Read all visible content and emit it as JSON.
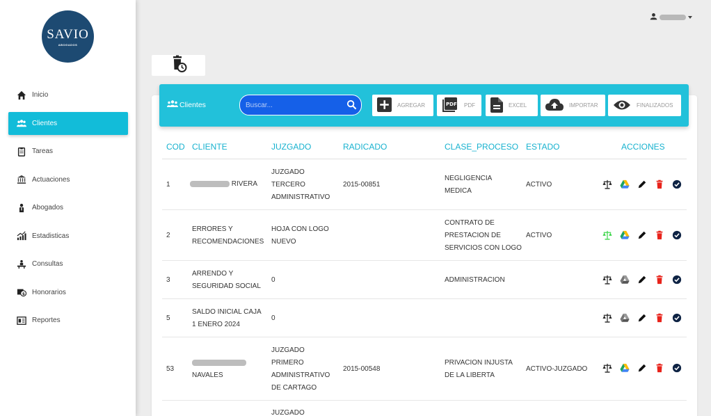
{
  "logo": {
    "main": "SAVIO",
    "sub": "ABOGADOS"
  },
  "nav": [
    {
      "label": "Inicio",
      "icon": "home-icon",
      "active": false
    },
    {
      "label": "Clientes",
      "icon": "users-icon",
      "active": true
    },
    {
      "label": "Tareas",
      "icon": "clipboard-icon",
      "active": false
    },
    {
      "label": "Actuaciones",
      "icon": "courthouse-icon",
      "active": false
    },
    {
      "label": "Abogados",
      "icon": "lawyer-icon",
      "active": false
    },
    {
      "label": "Estadisticas",
      "icon": "chart-icon",
      "active": false
    },
    {
      "label": "Consultas",
      "icon": "consult-icon",
      "active": false
    },
    {
      "label": "Honorarios",
      "icon": "money-icon",
      "active": false
    },
    {
      "label": "Reportes",
      "icon": "report-icon",
      "active": false
    }
  ],
  "banner": {
    "title": "Clientes",
    "search_placeholder": "Buscar...",
    "buttons": {
      "add": "AGREGAR",
      "pdf": "PDF",
      "excel": "EXCEL",
      "import": "IMPORTAR",
      "finished": "FINALIZADOS"
    },
    "pdf_icon_text": "PDF"
  },
  "table": {
    "headers": {
      "cod": "COD",
      "cliente": "CLIENTE",
      "juzgado": "JUZGADO",
      "radicado": "RADICADO",
      "clase": "CLASE_PROCESO",
      "estado": "ESTADO",
      "acciones": "ACCIONES"
    },
    "rows": [
      {
        "cod": "1",
        "cliente": "RIVERA",
        "juzgado": "JUZGADO TERCERO ADMINISTRATIVO",
        "radicado": "2015-00851",
        "clase": "NEGLIGENCIA MEDICA",
        "estado": "ACTIVO"
      },
      {
        "cod": "2",
        "cliente": "ERRORES Y RECOMENDACIONES",
        "juzgado": "HOJA CON LOGO NUEVO",
        "radicado": "",
        "clase": "CONTRATO DE PRESTACION DE SERVICIOS CON LOGO",
        "estado": "ACTIVO"
      },
      {
        "cod": "3",
        "cliente": "ARRENDO Y SEGURIDAD SOCIAL",
        "juzgado": "0",
        "radicado": "",
        "clase": "ADMINISTRACION",
        "estado": ""
      },
      {
        "cod": "5",
        "cliente": "SALDO INICIAL CAJA 1 ENERO 2024",
        "juzgado": "0",
        "radicado": "",
        "clase": "",
        "estado": ""
      },
      {
        "cod": "53",
        "cliente": "NAVALES",
        "juzgado": "JUZGADO PRIMERO ADMINISTRATIVO DE CARTAGO",
        "radicado": "2015-00548",
        "clase": "PRIVACION INJUSTA DE LA LIBERTA",
        "estado": "ACTIVO-JUZGADO"
      },
      {
        "cod": "",
        "cliente": "",
        "juzgado": "JUZGADO",
        "radicado": "",
        "clase": "",
        "estado": ""
      }
    ]
  },
  "colors": {
    "accent": "#22c1da",
    "search": "#1560e8",
    "delete": "#e8231b",
    "check": "#0e2344"
  }
}
